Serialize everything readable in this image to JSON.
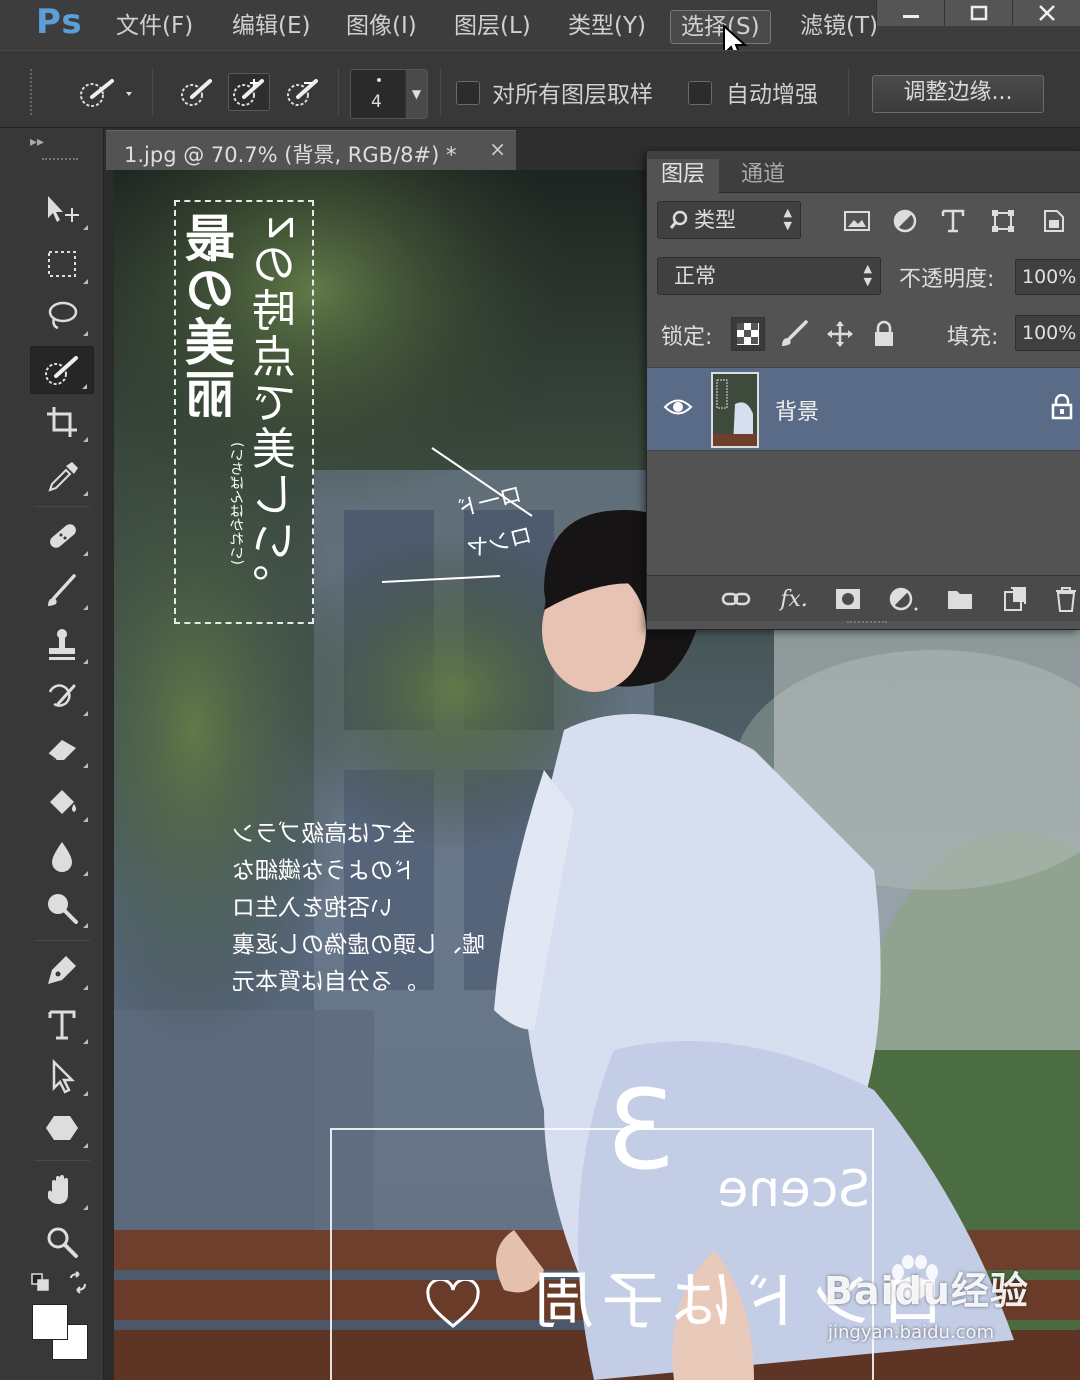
{
  "app": {
    "logo": "Ps"
  },
  "menu": [
    {
      "label": "文件(F)"
    },
    {
      "label": "编辑(E)"
    },
    {
      "label": "图像(I)"
    },
    {
      "label": "图层(L)"
    },
    {
      "label": "类型(Y)"
    },
    {
      "label": "选择(S)"
    },
    {
      "label": "滤镜(T)"
    }
  ],
  "options": {
    "brush_size": "4",
    "sample_all_layers": "对所有图层取样",
    "auto_enhance": "自动增强",
    "refine_edge": "调整边缘..."
  },
  "document": {
    "tab_label": "1.jpg @ 70.7% (背景, RGB/8#) *",
    "close": "×"
  },
  "canvas": {
    "title_col1": "最の美丽",
    "title_col1_sub": "(いちばんはかれい)",
    "title_col2": "zの時点で美しい。",
    "side_label_1": "ロ一ド",
    "side_label_2": "ロンヤ",
    "body_lines": [
      "全ては高級ブラン",
      "ドのような繊細な",
      "い否抱を入生ロ",
      "嘘、し頭の虚偽のし返裏",
      "。る分自は質本元"
    ],
    "scene_number": "3",
    "scene_word": "Scene",
    "bottom_line": "ロンドは子周"
  },
  "layers_panel": {
    "tabs": [
      "图层",
      "通道"
    ],
    "filter_label": "类型",
    "blend_mode": "正常",
    "opacity_label": "不透明度:",
    "opacity_value": "100%",
    "lock_label": "锁定:",
    "fill_label": "填充:",
    "fill_value": "100%",
    "layer_name": "背景"
  },
  "watermark": {
    "main": "Baidu经验",
    "url": "jingyan.baidu.com"
  }
}
